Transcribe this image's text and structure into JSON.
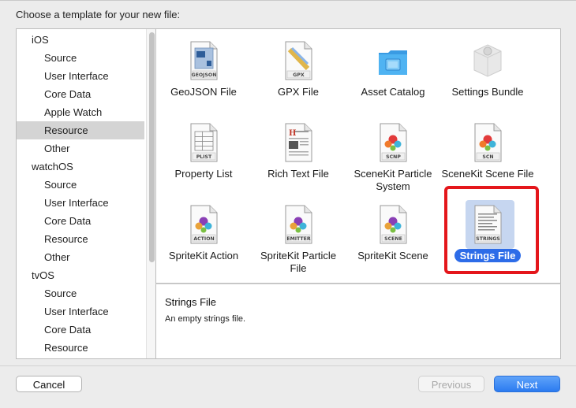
{
  "dialog": {
    "title": "Choose a template for your new file:"
  },
  "sidebar": {
    "rows": [
      {
        "kind": "section",
        "label": "iOS"
      },
      {
        "kind": "item",
        "label": "Source"
      },
      {
        "kind": "item",
        "label": "User Interface"
      },
      {
        "kind": "item",
        "label": "Core Data"
      },
      {
        "kind": "item",
        "label": "Apple Watch"
      },
      {
        "kind": "item",
        "label": "Resource",
        "selected": true
      },
      {
        "kind": "item",
        "label": "Other"
      },
      {
        "kind": "section",
        "label": "watchOS"
      },
      {
        "kind": "item",
        "label": "Source"
      },
      {
        "kind": "item",
        "label": "User Interface"
      },
      {
        "kind": "item",
        "label": "Core Data"
      },
      {
        "kind": "item",
        "label": "Resource"
      },
      {
        "kind": "item",
        "label": "Other"
      },
      {
        "kind": "section",
        "label": "tvOS"
      },
      {
        "kind": "item",
        "label": "Source"
      },
      {
        "kind": "item",
        "label": "User Interface"
      },
      {
        "kind": "item",
        "label": "Core Data"
      },
      {
        "kind": "item",
        "label": "Resource"
      }
    ]
  },
  "templates": [
    {
      "label": "GeoJSON File",
      "icon": "geojson-file-icon",
      "badge": "GEOJSON",
      "kind": "doc"
    },
    {
      "label": "GPX File",
      "icon": "gpx-file-icon",
      "badge": "GPX",
      "kind": "doc"
    },
    {
      "label": "Asset Catalog",
      "icon": "asset-catalog-icon",
      "badge": "",
      "kind": "folder"
    },
    {
      "label": "Settings Bundle",
      "icon": "settings-bundle-icon",
      "badge": "",
      "kind": "box"
    },
    {
      "label": "Property List",
      "icon": "property-list-icon",
      "badge": "PLIST",
      "kind": "doc"
    },
    {
      "label": "Rich Text File",
      "icon": "rich-text-file-icon",
      "badge": "",
      "kind": "rtf"
    },
    {
      "label": "SceneKit Particle System",
      "icon": "scenekit-particle-system-icon",
      "badge": "SCNP",
      "kind": "scene"
    },
    {
      "label": "SceneKit Scene File",
      "icon": "scenekit-scene-file-icon",
      "badge": "SCN",
      "kind": "scene"
    },
    {
      "label": "SpriteKit Action",
      "icon": "spritekit-action-icon",
      "badge": "ACTION",
      "kind": "sprite"
    },
    {
      "label": "SpriteKit Particle File",
      "icon": "spritekit-particle-file-icon",
      "badge": "EMITTER",
      "kind": "sprite"
    },
    {
      "label": "SpriteKit Scene",
      "icon": "spritekit-scene-icon",
      "badge": "SCENE",
      "kind": "sprite"
    },
    {
      "label": "Strings File",
      "icon": "strings-file-icon",
      "badge": "STRINGS",
      "kind": "strings",
      "selected": true
    }
  ],
  "description": {
    "title": "Strings File",
    "text": "An empty strings file."
  },
  "buttons": {
    "cancel": "Cancel",
    "previous": "Previous",
    "next": "Next"
  },
  "colors": {
    "selection_blue": "#2d6ce8",
    "highlight_red": "#e4161b"
  }
}
